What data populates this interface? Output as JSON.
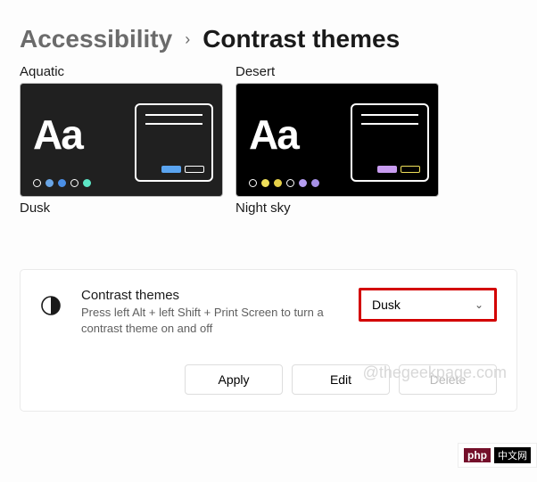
{
  "breadcrumb": {
    "parent": "Accessibility",
    "current": "Contrast themes"
  },
  "themes": {
    "aquatic": {
      "label": "Aquatic",
      "label2": "Dusk",
      "aa": "Aa",
      "dots": [
        "#ffffff00",
        "#6aa6e6",
        "#4a8fe6",
        "#ffffff00",
        "#5de6c6"
      ],
      "mini_btn_fill": "#5aa4f0",
      "mini_btn_outline": "#ffffff"
    },
    "desert": {
      "label": "Desert",
      "label2": "Night sky",
      "aa": "Aa",
      "dots": [
        "#ffffff00",
        "#f0e05a",
        "#e6d048",
        "#ffffff00",
        "#b49cf0",
        "#a690e6"
      ],
      "mini_btn_fill": "#c89cf0",
      "mini_btn_outline": "#f0e05a"
    }
  },
  "card": {
    "title": "Contrast themes",
    "description": "Press left Alt + left Shift + Print Screen to turn a contrast theme on and off",
    "dropdown": {
      "value": "Dusk"
    },
    "buttons": {
      "apply": "Apply",
      "edit": "Edit",
      "delete": "Delete"
    }
  },
  "watermark": "@thegeekpage.com",
  "badge": {
    "left": "php",
    "right": "中文网"
  }
}
